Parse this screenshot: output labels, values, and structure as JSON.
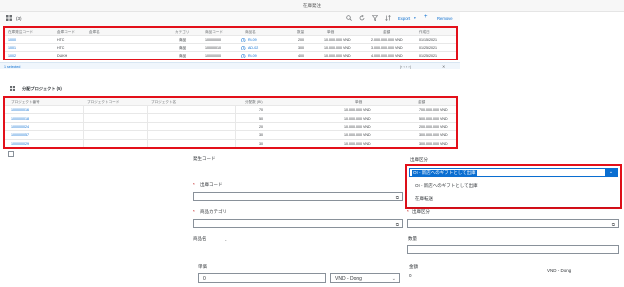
{
  "window": {
    "title": "在庫発注"
  },
  "toolbar": {
    "count": "(3)",
    "export_label": "Export",
    "remove_label": "Remove"
  },
  "table1": {
    "headers": [
      "在庫発注コード",
      "倉庫コード",
      "倉庫名",
      "カテゴリ",
      "商品コード",
      "商品名",
      "数量",
      "単価",
      "金額",
      "作成日"
    ],
    "rows": [
      [
        "1000",
        "HTC",
        "",
        "商品",
        "10000000",
        "Ri-09",
        "200",
        "10.000.000 VND",
        "2.000.000.000 VND",
        "01/15/2021"
      ],
      [
        "1001",
        "HTC",
        "",
        "商品",
        "10000010",
        "AD-02",
        "300",
        "10.000.000 VND",
        "3.000.000.000 VND",
        "01/25/2021"
      ],
      [
        "1002",
        "DUKH",
        "",
        "商品",
        "10000000",
        "Ri-09",
        "400",
        "10.000.000 VND",
        "4.000.000.000 VND",
        "01/25/2021"
      ]
    ],
    "selected_text": "1 selected"
  },
  "table2": {
    "title": "分配プロジェクト (5)",
    "headers": [
      "プロジェクト番号",
      "プロジェクトコード",
      "プロジェクト名",
      "分配数 (BI)",
      "単価",
      "金額"
    ],
    "rows": [
      [
        "100000016",
        "",
        "",
        "70",
        "10.000.000 VND",
        "700.000.000 VND"
      ],
      [
        "100000018",
        "",
        "",
        "50",
        "10.000.000 VND",
        "500.000.000 VND"
      ],
      [
        "100000024",
        "",
        "",
        "20",
        "10.000.000 VND",
        "200.000.000 VND"
      ],
      [
        "100000057",
        "",
        "",
        "30",
        "10.000.000 VND",
        "300.000.000 VND"
      ],
      [
        "100000029",
        "",
        "",
        "30",
        "10.000.000 VND",
        "300.000.000 VND"
      ]
    ]
  },
  "form": {
    "generation_code_label": "発生コード",
    "issue_code_label": "出庫コード",
    "product_category_label": "商品カテゴリ",
    "product_name_label": "商品名",
    "product_name_value": "-",
    "unit_price_label": "単価",
    "unit_price_value": "0",
    "currency_value": "VND - Dong",
    "right_issue_type_label": "出庫区分",
    "right_issue_type2_label": "出庫区分",
    "quantity_label": "数量",
    "amount_label": "金額",
    "amount_value": "0",
    "amount_currency": "VND - Dong"
  },
  "dropdown": {
    "selected": "OI - 新店へのギフトとして出庫",
    "options": [
      "OI - 新店へのギフトとして出庫",
      "在庫転送"
    ]
  }
}
